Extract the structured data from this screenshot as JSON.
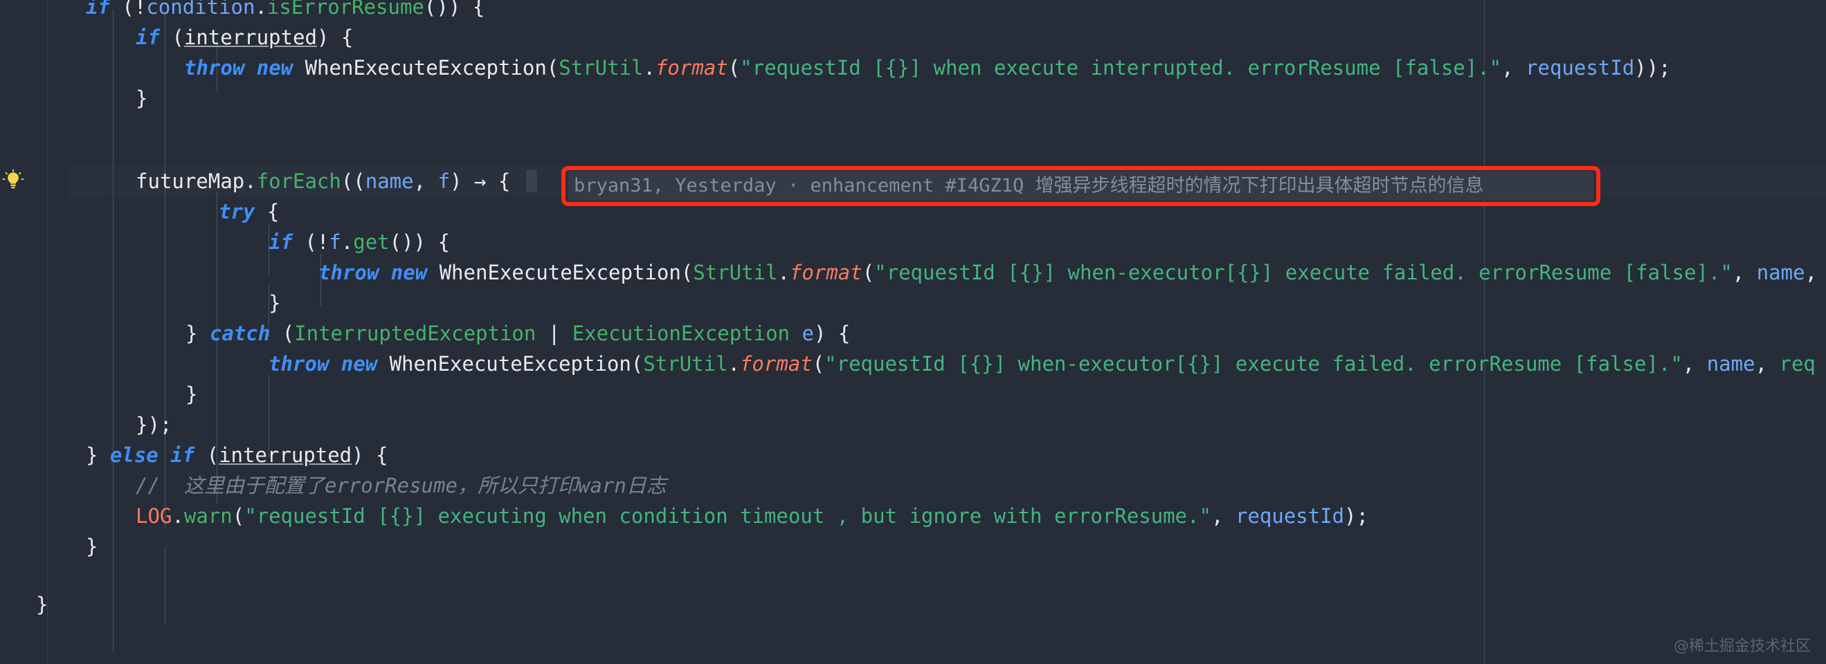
{
  "editor": {
    "theme_name": "darcula-dark",
    "background_color": "#262c38",
    "gutter_color": "#262c38",
    "current_line_color": "#2a313d",
    "indent_guide_color": "#4a5263",
    "margin_guide_color": "#434b59",
    "font_size_px": 29,
    "line_height_px": 44
  },
  "gutter": {
    "bulb_icon": "lightbulb-icon",
    "bulb_icon_color": "#f6d546",
    "bulb_line_index": 5
  },
  "annotation": {
    "author": "bryan31",
    "date": "Yesterday",
    "separator": "·",
    "type": "enhancement",
    "issue_id": "#I4GZ1Q",
    "message": "增强异步线程超时的情况下打印出具体超时节点的信息",
    "full_text": "bryan31, Yesterday · enhancement #I4GZ1Q 增强异步线程超时的情况下打印出具体超时节点的信息",
    "text_color": "#868d99",
    "background_color": "#343b47",
    "highlight_border_color": "#ff2d16"
  },
  "watermark": {
    "text": "@稀土掘金技术社区",
    "color": "#5d6470"
  },
  "code": {
    "language": "java",
    "lines": [
      {
        "indent": 2,
        "plain": "if (!condition.isErrorResume()) {"
      },
      {
        "indent": 3,
        "plain": "if (interrupted) {"
      },
      {
        "indent": 4,
        "plain": "throw new WhenExecuteException(StrUtil.format(\"requestId [{}] when execute interrupted. errorResume [false].\", requestId));"
      },
      {
        "indent": 3,
        "plain": "}"
      },
      {
        "indent": 0,
        "plain": ""
      },
      {
        "indent": 3,
        "plain": "futureMap.forEach((name, f) -> {"
      },
      {
        "indent": 4,
        "plain": "try {"
      },
      {
        "indent": 5,
        "plain": "if (!f.get()) {"
      },
      {
        "indent": 6,
        "plain": "throw new WhenExecuteException(StrUtil.format(\"requestId [{}] when-executor[{}] execute failed. errorResume [false].\", name,"
      },
      {
        "indent": 5,
        "plain": "}"
      },
      {
        "indent": 4,
        "plain": "} catch (InterruptedException | ExecutionException e) {"
      },
      {
        "indent": 5,
        "plain": "throw new WhenExecuteException(StrUtil.format(\"requestId [{}] when-executor[{}] execute failed. errorResume [false].\", name, req"
      },
      {
        "indent": 4,
        "plain": "}"
      },
      {
        "indent": 3,
        "plain": "});"
      },
      {
        "indent": 2,
        "plain": "} else if (interrupted) {"
      },
      {
        "indent": 3,
        "plain": "// 这里由于配置了errorResume，所以只打印warn日志"
      },
      {
        "indent": 3,
        "plain": "LOG.warn(\"requestId [{}] executing when condition timeout , but ignore with errorResume.\", requestId);"
      },
      {
        "indent": 2,
        "plain": "}"
      },
      {
        "indent": 1,
        "plain": "}"
      }
    ],
    "string_literals": [
      "requestId [{}] when execute interrupted. errorResume [false].",
      "requestId [{}] when-executor[{}] execute failed. errorResume [false].",
      "requestId [{}] executing when condition timeout , but ignore with errorResume."
    ],
    "identifiers": [
      "condition",
      "isErrorResume",
      "interrupted",
      "WhenExecuteException",
      "StrUtil",
      "format",
      "requestId",
      "futureMap",
      "forEach",
      "name",
      "f",
      "get",
      "InterruptedException",
      "ExecutionException",
      "e",
      "LOG",
      "warn"
    ],
    "keywords": [
      "if",
      "throw",
      "new",
      "try",
      "catch",
      "else"
    ],
    "colors": {
      "keyword": "#3f8ff7",
      "plain": "#e9eced",
      "identifier": "#6fa8f5",
      "method": "#45b36b",
      "string": "#43b581",
      "static_method": "#f97c5c",
      "comment": "#7a8290"
    }
  }
}
